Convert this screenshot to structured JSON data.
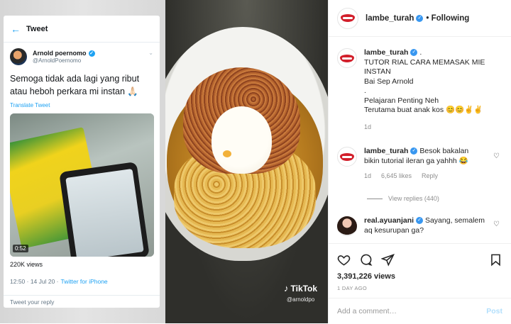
{
  "tweet": {
    "header_title": "Tweet",
    "back_icon": "arrow-left-icon",
    "author_name": "Arnold poernomo",
    "author_handle": "@ArnoldPoernomo",
    "text": "Semoga tidak ada lagi yang ribut atau heboh perkara mi instan 🙏🏻",
    "translate_label": "Translate Tweet",
    "video_duration": "0:52",
    "views": "220K views",
    "time": "12:50 · 14 Jul 20 ·",
    "source": "Twitter for iPhone",
    "reply_placeholder": "Tweet your reply"
  },
  "video_overlay": {
    "brand": "TikTok",
    "handle": "@arnoldpo"
  },
  "post": {
    "username": "lambe_turah",
    "follow_status": "• Following",
    "caption_lines": [
      "TUTOR RIAL CARA MEMASAK MIE INSTAN",
      "Bai Sep Arnold",
      ".",
      "Pelajaran Penting Neh",
      "Terutama buat anak kos 😊😊✌✌"
    ],
    "caption_prefix": ".",
    "caption_time": "1d",
    "comments": [
      {
        "username": "lambe_turah",
        "text": "Besok bakalan bikin tutorial ileran ga yahhh 😂",
        "time": "1d",
        "likes": "6,645 likes",
        "reply_label": "Reply",
        "view_replies": "View replies (440)"
      },
      {
        "username": "real.ayuanjani",
        "text": "Sayang, semalem aq kesurupan ga?"
      }
    ],
    "view_count": "3,391,226 views",
    "posted_ago": "1 DAY AGO",
    "comment_placeholder": "Add a comment…",
    "post_label": "Post"
  },
  "colors": {
    "twitter_blue": "#1da1f2",
    "instagram_verified": "#3897f0",
    "post_disabled": "#b2dffc",
    "meta_gray": "#8e8e8e"
  }
}
